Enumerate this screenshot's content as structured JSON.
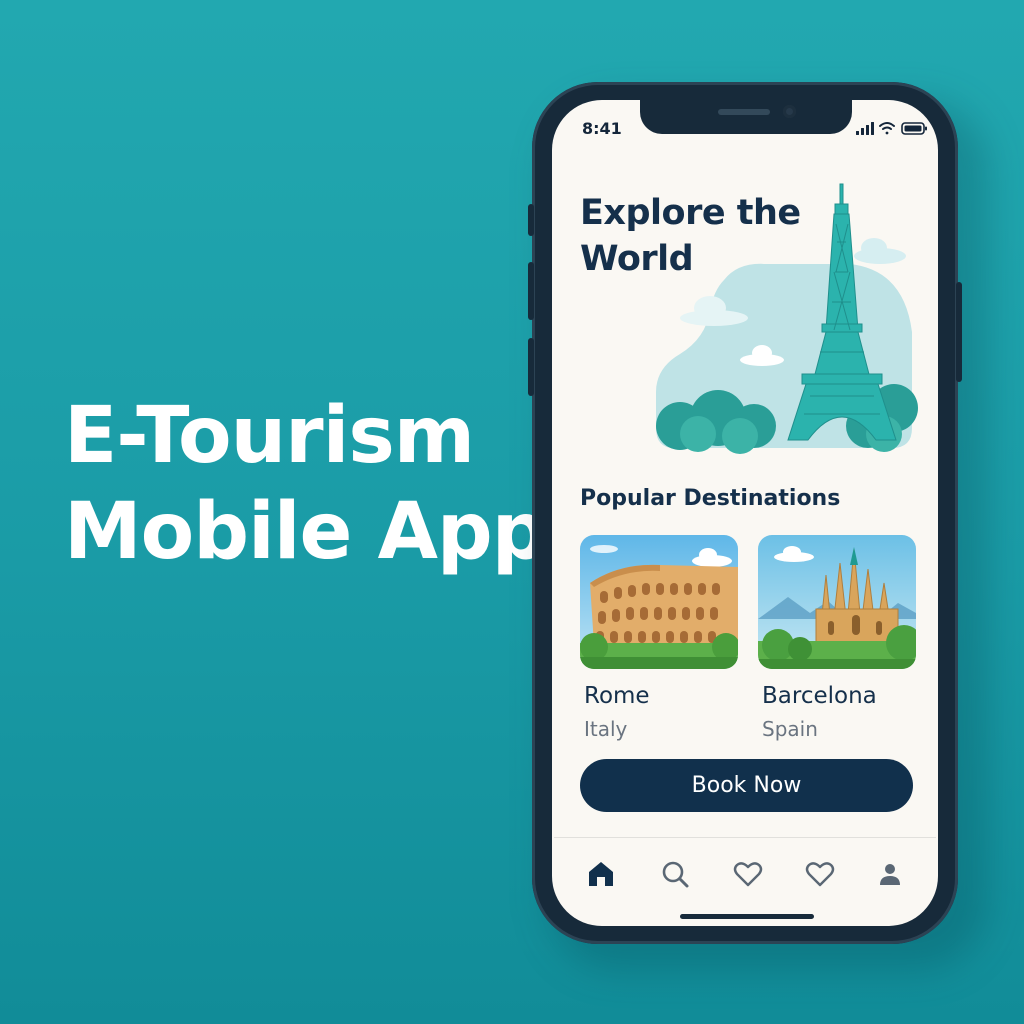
{
  "headline": {
    "line1": "E-Tourism",
    "line2": "Mobile App"
  },
  "status_bar": {
    "time": "8:41"
  },
  "hero": {
    "title_line1": "Explore the",
    "title_line2": "World"
  },
  "section": {
    "title": "Popular Destinations"
  },
  "destinations": [
    {
      "city": "Rome",
      "country": "Italy",
      "image": "colosseum-illustration"
    },
    {
      "city": "Barcelona",
      "country": "Spain",
      "image": "sagrada-familia-illustration"
    }
  ],
  "cta": {
    "label": "Book Now"
  },
  "bottom_nav": [
    {
      "icon": "home-icon",
      "active": true
    },
    {
      "icon": "search-icon",
      "active": false
    },
    {
      "icon": "heart-icon",
      "active": false
    },
    {
      "icon": "heart-icon",
      "active": false
    },
    {
      "icon": "profile-icon",
      "active": false
    }
  ],
  "colors": {
    "background": "#1a9ba6",
    "phone_frame": "#172a3a",
    "screen": "#faf8f3",
    "primary": "#11304c",
    "accent": "#2bb3ad"
  }
}
